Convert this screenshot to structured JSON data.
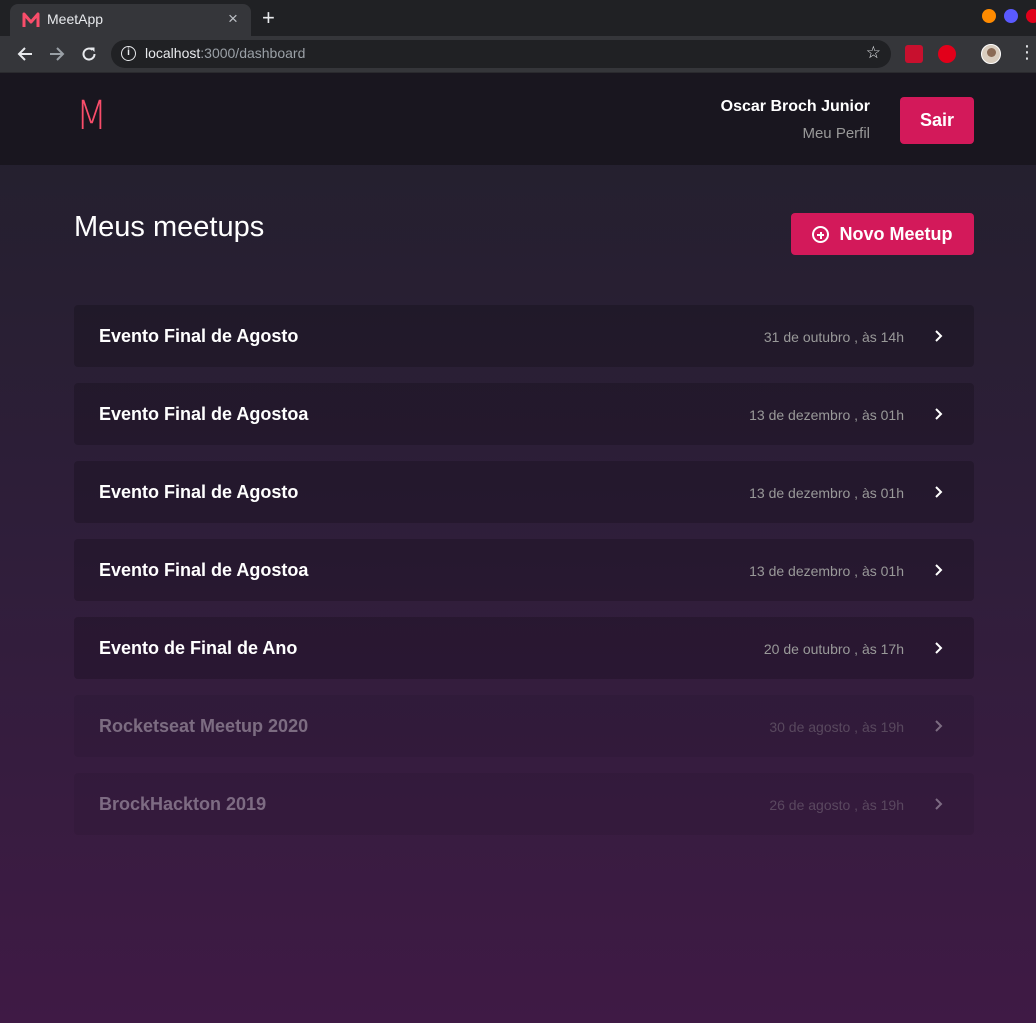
{
  "browser": {
    "tab_title": "MeetApp",
    "tab_close": "×",
    "new_tab": "+",
    "url_host": "localhost",
    "url_rest": ":3000/dashboard",
    "window_controls": [
      "#ff8b00",
      "#5a5aff",
      "#e0001a"
    ]
  },
  "header": {
    "logo": "M",
    "user_name": "Oscar Broch Junior",
    "profile_link": "Meu Perfil",
    "logout_label": "Sair"
  },
  "main": {
    "title": "Meus meetups",
    "new_button_label": "Novo Meetup",
    "meetups": [
      {
        "title": "Evento Final de Agosto",
        "date": "31 de outubro , às 14h",
        "past": false
      },
      {
        "title": "Evento Final de Agostoa",
        "date": "13 de dezembro , às 01h",
        "past": false
      },
      {
        "title": "Evento Final de Agosto",
        "date": "13 de dezembro , às 01h",
        "past": false
      },
      {
        "title": "Evento Final de Agostoa",
        "date": "13 de dezembro , às 01h",
        "past": false
      },
      {
        "title": "Evento de Final de Ano",
        "date": "20 de outubro , às 17h",
        "past": false
      },
      {
        "title": "Rocketseat Meetup 2020",
        "date": "30 de agosto , às 19h",
        "past": true
      },
      {
        "title": "BrockHackton 2019",
        "date": "26 de agosto , às 19h",
        "past": true
      }
    ]
  },
  "colors": {
    "accent": "#d3195a",
    "logo": "#f94d6a"
  }
}
